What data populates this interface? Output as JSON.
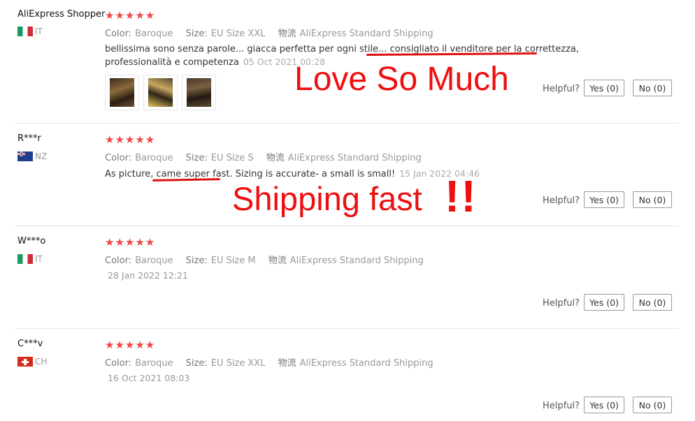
{
  "reviews": [
    {
      "name": "AliExpress Shopper",
      "country": "IT",
      "stars": "★★★★★",
      "color_label": "Color:",
      "color": "Baroque",
      "size_label": "Size:",
      "size": "EU Size XXL",
      "shipping_label": "物流",
      "shipping": "AliExpress Standard Shipping",
      "text_a": "bellissima sono senza parole... giacca perfetta per ogni stile... ",
      "text_b": "consigliato il venditore per la correttezza",
      "text_c": ", professionalità e competenza",
      "date": "05 Oct 2021 00:28",
      "helpful": "Helpful?",
      "yes": "Yes (0)",
      "no": "No (0)"
    },
    {
      "name": "R***r",
      "country": "NZ",
      "stars": "★★★★★",
      "color_label": "Color:",
      "color": "Baroque",
      "size_label": "Size:",
      "size": "EU Size S",
      "shipping_label": "物流",
      "shipping": "AliExpress Standard Shipping",
      "text_a": "As picture, ",
      "text_b": "came super fast",
      "text_c": ". Sizing is accurate- a small is small!",
      "date": "15 Jan 2022 04:46",
      "helpful": "Helpful?",
      "yes": "Yes (0)",
      "no": "No (0)"
    },
    {
      "name": "W***o",
      "country": "IT",
      "stars": "★★★★★",
      "color_label": "Color:",
      "color": "Baroque",
      "size_label": "Size:",
      "size": "EU Size M",
      "shipping_label": "物流",
      "shipping": "AliExpress Standard Shipping",
      "date": "28 Jan 2022 12:21",
      "helpful": "Helpful?",
      "yes": "Yes (0)",
      "no": "No (0)"
    },
    {
      "name": "C***v",
      "country": "CH",
      "stars": "★★★★★",
      "color_label": "Color:",
      "color": "Baroque",
      "size_label": "Size:",
      "size": "EU Size XXL",
      "shipping_label": "物流",
      "shipping": "AliExpress Standard Shipping",
      "date": "16 Oct 2021 08:03",
      "helpful": "Helpful?",
      "yes": "Yes (0)",
      "no": "No (0)"
    }
  ],
  "annotations": {
    "love": "Love So Much",
    "shipping": "Shipping fast",
    "exclaim": "!!"
  },
  "colors": {
    "star": "#f14444",
    "annotation": "#ee1010"
  }
}
